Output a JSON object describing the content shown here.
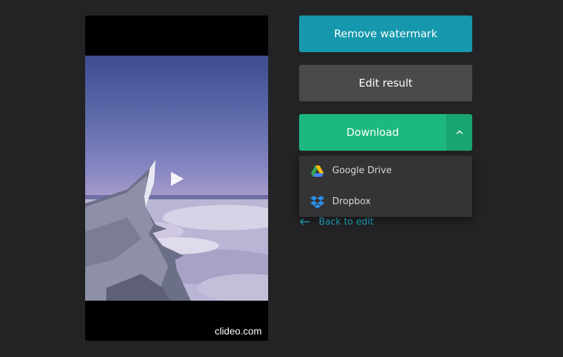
{
  "player": {
    "watermark": "clideo.com"
  },
  "actions": {
    "remove_watermark_label": "Remove watermark",
    "edit_result_label": "Edit result",
    "download_label": "Download"
  },
  "download_menu": {
    "items": [
      {
        "label": "Google Drive",
        "icon": "google-drive-icon"
      },
      {
        "label": "Dropbox",
        "icon": "dropbox-icon"
      }
    ]
  },
  "back_link": {
    "label": "Back to edit",
    "icon": "arrow-left-icon"
  },
  "colors": {
    "background": "#232325",
    "remove_watermark": "#1598ad",
    "edit_result": "#4a4a4c",
    "download": "#1db880",
    "download_toggle": "#19a571",
    "link": "#1a8fa5"
  }
}
